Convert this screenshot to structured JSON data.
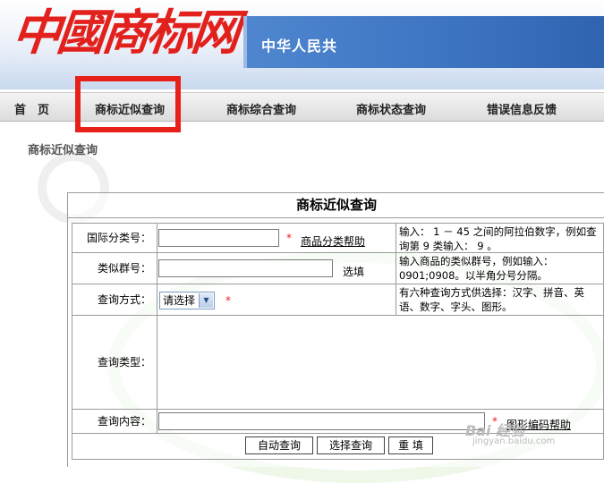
{
  "header": {
    "logo_text": "中國商标网",
    "banner_text": "中华人民共"
  },
  "nav": {
    "items": [
      {
        "label": "首　页"
      },
      {
        "label": "商标近似查询"
      },
      {
        "label": "商标综合查询"
      },
      {
        "label": "商标状态查询"
      },
      {
        "label": "错误信息反馈"
      }
    ]
  },
  "page": {
    "subtitle": "商标近似查询"
  },
  "form": {
    "title": "商标近似查询",
    "rows": {
      "intl_class": {
        "label": "国际分类号：",
        "value": "",
        "required_mark": "*",
        "help_link": "商品分类帮助",
        "note": "输入： 1 － 45 之间的阿拉伯数字，例如查询第 9 类输入： 9 。"
      },
      "similar_group": {
        "label": "类似群号：",
        "value": "",
        "optional": "选填",
        "note": "输入商品的类似群号，例如输入：0901;0908。以半角分号分隔。"
      },
      "query_method": {
        "label": "查询方式：",
        "selected": "请选择",
        "required_mark": "*",
        "note": "有六种查询方式供选择：汉字、拼音、英语、数字、字头、图形。"
      },
      "query_type": {
        "label": "查询类型："
      },
      "query_content": {
        "label": "查询内容：",
        "value": "",
        "required_mark": "*",
        "help_link": "图形编码帮助"
      }
    },
    "buttons": {
      "auto": "自动查询",
      "select": "选择查询",
      "reset": "重 填"
    }
  },
  "watermark": {
    "main": "Bai 经验",
    "sub": "jingyan.baidu.com"
  }
}
